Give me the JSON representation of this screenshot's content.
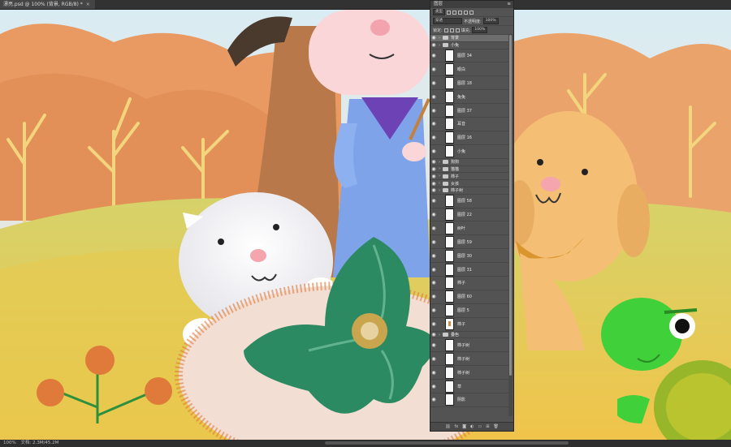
{
  "document_tab": {
    "title": "漂亮.psd @ 100% (背景, RGB/8) *",
    "close": "×"
  },
  "status": {
    "zoom": "100%",
    "doc_info": "文档: 2.3M/45.2M"
  },
  "layers_panel": {
    "title": "图层",
    "menu": "≡",
    "filter_kind": "类型",
    "blend_mode": "穿透",
    "opacity_label": "不透明度:",
    "opacity_value": "100%",
    "lock_label": "锁定:",
    "fill_label": "填充:",
    "fill_value": "100%",
    "layers": [
      {
        "name": "背景",
        "kind": "group",
        "indent": 0
      },
      {
        "name": "小兔",
        "kind": "group",
        "indent": 0
      },
      {
        "name": "图层 34",
        "kind": "layer",
        "indent": 1
      },
      {
        "name": "眼白",
        "kind": "layer",
        "indent": 1
      },
      {
        "name": "图层 18",
        "kind": "layer",
        "indent": 1
      },
      {
        "name": "兔兔",
        "kind": "layer",
        "indent": 1
      },
      {
        "name": "图层 37",
        "kind": "layer",
        "indent": 1
      },
      {
        "name": "耳音",
        "kind": "layer",
        "indent": 1
      },
      {
        "name": "图层 16",
        "kind": "layer",
        "indent": 1
      },
      {
        "name": "小兔",
        "kind": "layer",
        "indent": 1
      },
      {
        "name": "狗狗",
        "kind": "group",
        "indent": 0
      },
      {
        "name": "猫猫",
        "kind": "group",
        "indent": 0
      },
      {
        "name": "柿子",
        "kind": "group",
        "indent": 0
      },
      {
        "name": "女孩",
        "kind": "group",
        "indent": 0
      },
      {
        "name": "柿子树",
        "kind": "group",
        "indent": 0
      },
      {
        "name": "图层 58",
        "kind": "layer",
        "indent": 1
      },
      {
        "name": "图层 22",
        "kind": "layer",
        "indent": 1
      },
      {
        "name": "树叶",
        "kind": "layer",
        "indent": 1
      },
      {
        "name": "图层 59",
        "kind": "layer",
        "indent": 1
      },
      {
        "name": "图层 30",
        "kind": "layer",
        "indent": 1
      },
      {
        "name": "图层 31",
        "kind": "layer",
        "indent": 1
      },
      {
        "name": "柿子",
        "kind": "layer",
        "indent": 1
      },
      {
        "name": "图层 60",
        "kind": "layer",
        "indent": 1
      },
      {
        "name": "图层 5",
        "kind": "layer",
        "indent": 1
      },
      {
        "name": "柿子",
        "kind": "image",
        "indent": 1
      },
      {
        "name": "叠色",
        "kind": "group",
        "indent": 0
      },
      {
        "name": "柿子树",
        "kind": "layer",
        "indent": 1
      },
      {
        "name": "柿子树",
        "kind": "layer",
        "indent": 1
      },
      {
        "name": "柿子树",
        "kind": "layer",
        "indent": 1
      },
      {
        "name": "草",
        "kind": "layer",
        "indent": 1
      },
      {
        "name": "阴影",
        "kind": "layer",
        "indent": 1
      }
    ],
    "footer_icons": [
      "link-icon",
      "fx-icon",
      "mask-icon",
      "adjustment-icon",
      "folder-icon",
      "new-layer-icon",
      "trash-icon"
    ]
  },
  "colors": {
    "ps_dark": "#282828",
    "panel": "#535353",
    "persimmon": "#e07a3a",
    "leaf": "#2b8a62",
    "sky": "#cfe5ef"
  }
}
